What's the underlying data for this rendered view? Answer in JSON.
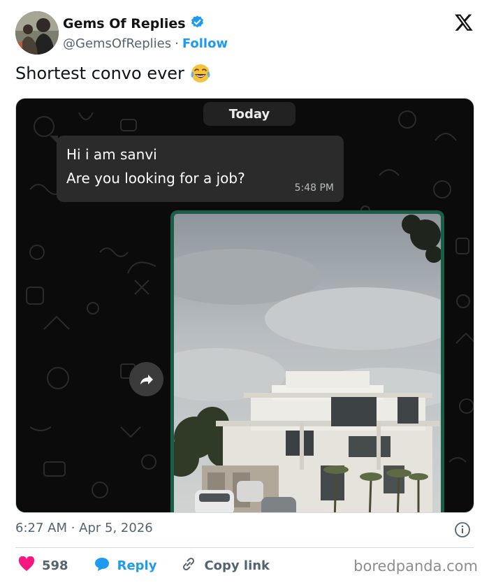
{
  "author": {
    "name": "Gems Of Replies",
    "handle": "@GemsOfReplies",
    "separator": "·",
    "follow_label": "Follow",
    "verified_icon": "verified-badge-icon"
  },
  "tweet": {
    "text": "Shortest convo ever",
    "emoji": "😂"
  },
  "chat": {
    "date_label": "Today",
    "messages": [
      {
        "line1": "Hi i am sanvi",
        "line2": "Are you looking for a job?",
        "time": "5:48 PM"
      }
    ]
  },
  "meta": {
    "timestamp": "6:27 AM · Apr 5, 2026"
  },
  "actions": {
    "like_count": "598",
    "reply_label": "Reply",
    "copy_label": "Copy link"
  },
  "watermark": "boredpanda.com",
  "colors": {
    "accent": "#1d9bf0",
    "like": "#f91880",
    "text": "#0f1419",
    "muted": "#536471",
    "chat_bg": "#0b0b0b",
    "bubble": "#2a2b2a",
    "media_border": "#1b5e47"
  }
}
